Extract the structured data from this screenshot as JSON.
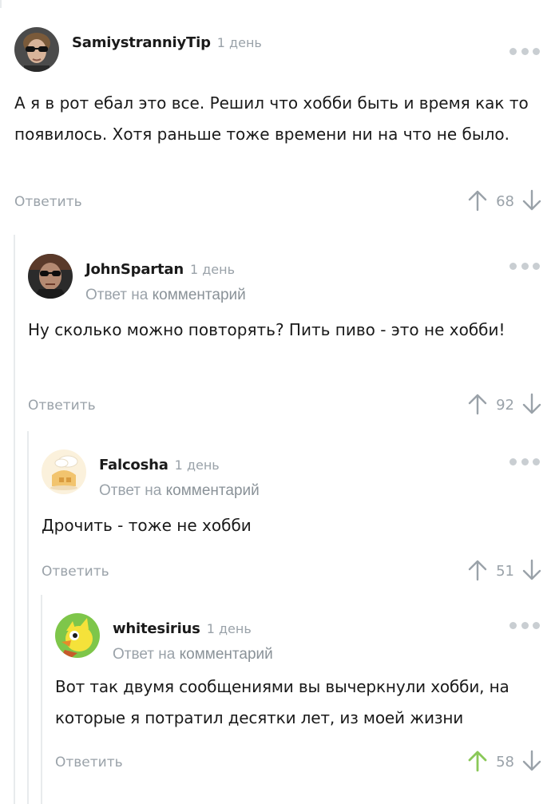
{
  "colors": {
    "muted": "#9aa2a9",
    "vote_active": "#8ac858",
    "thread_line": "#e8ebed",
    "text": "#1a1a1a"
  },
  "comments": [
    {
      "username": "SamiystranniyTip",
      "time": "1 день",
      "reply_to": null,
      "text": "А я в рот ебал это все. Решил что хобби быть и время как то появилось. Хотя раньше тоже времени ни на что не было.",
      "reply_label": "Ответить",
      "rating": "68",
      "upvoted": false,
      "avatar": "man-sunglasses-avatar"
    },
    {
      "username": "JohnSpartan",
      "time": "1 день",
      "reply_to": {
        "prefix": "Ответ на",
        "link": "комментарий"
      },
      "text": "Ну сколько можно повторять? Пить пиво - это не хобби!",
      "reply_label": "Ответить",
      "rating": "92",
      "upvoted": false,
      "avatar": "action-hero-avatar"
    },
    {
      "username": "Falcosha",
      "time": "1 день",
      "reply_to": {
        "prefix": "Ответ на",
        "link": "комментарий"
      },
      "text": "Дрочить - тоже не хобби",
      "reply_label": "Ответить",
      "rating": "51",
      "upvoted": false,
      "avatar": "cartoon-house-avatar"
    },
    {
      "username": "whitesirius",
      "time": "1 день",
      "reply_to": {
        "prefix": "Ответ на",
        "link": "комментарий"
      },
      "text": "Вот так двумя сообщениями вы вычеркнули хобби, на которые я потратил десятки лет, из моей жизни",
      "reply_label": "Ответить",
      "rating": "58",
      "upvoted": true,
      "avatar": "yellow-bird-avatar"
    }
  ]
}
